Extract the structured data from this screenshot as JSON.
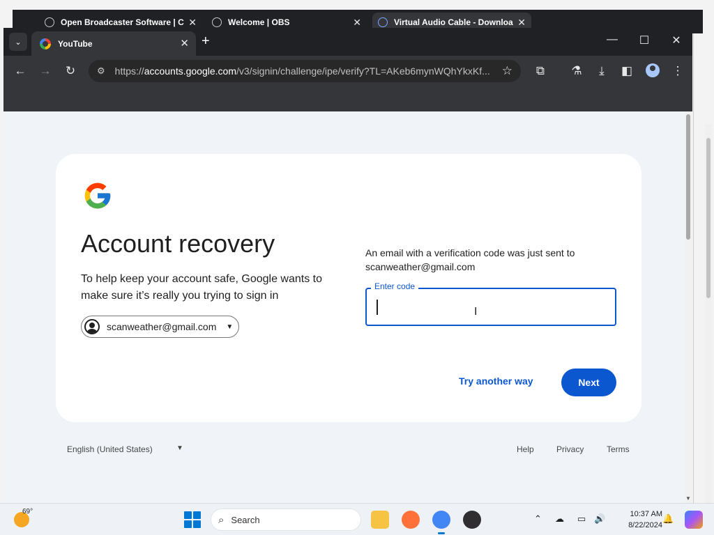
{
  "background_window": {
    "tabs": [
      {
        "label": "Open Broadcaster Software | C"
      },
      {
        "label": "Welcome | OBS"
      },
      {
        "label": "Virtual Audio Cable - Downloa"
      }
    ]
  },
  "browser": {
    "active_tab": {
      "label": "YouTube",
      "close": "✕"
    },
    "new_tab": "+",
    "tab_search": "⌄",
    "window_controls": {
      "minimize": "—",
      "maximize": "☐",
      "close": "✕"
    },
    "url_prefix": "https://",
    "url_domain": "accounts.google.com",
    "url_path": "/v3/signin/challenge/ipe/verify?TL=AKeb6mynWQhYkxKf...",
    "icons": {
      "back": "←",
      "forward": "→",
      "reload": "↻",
      "site_info": "⚙",
      "star": "☆",
      "extensions": "⧉",
      "labs": "⚗",
      "downloads": "⤓",
      "side_panel": "◧",
      "menu": "⋮"
    }
  },
  "page": {
    "title": "Account recovery",
    "subtitle": "To help keep your account safe, Google wants to make sure it’s really you trying to sign in",
    "account_email": "scanweather@gmail.com",
    "info_text": "An email with a verification code was just sent to scanweather@gmail.com",
    "code_label": "Enter code",
    "code_value": "",
    "try_another_way": "Try another way",
    "next": "Next",
    "footer": {
      "language": "English (United States)",
      "help": "Help",
      "privacy": "Privacy",
      "terms": "Terms"
    }
  },
  "taskbar": {
    "temperature": "69°",
    "search_label": "Search",
    "time": "10:37 AM",
    "date": "8/22/2024"
  },
  "colors": {
    "accent_blue": "#0b57d0",
    "page_bg": "#f0f4f9",
    "chrome_dark": "#35363a"
  }
}
